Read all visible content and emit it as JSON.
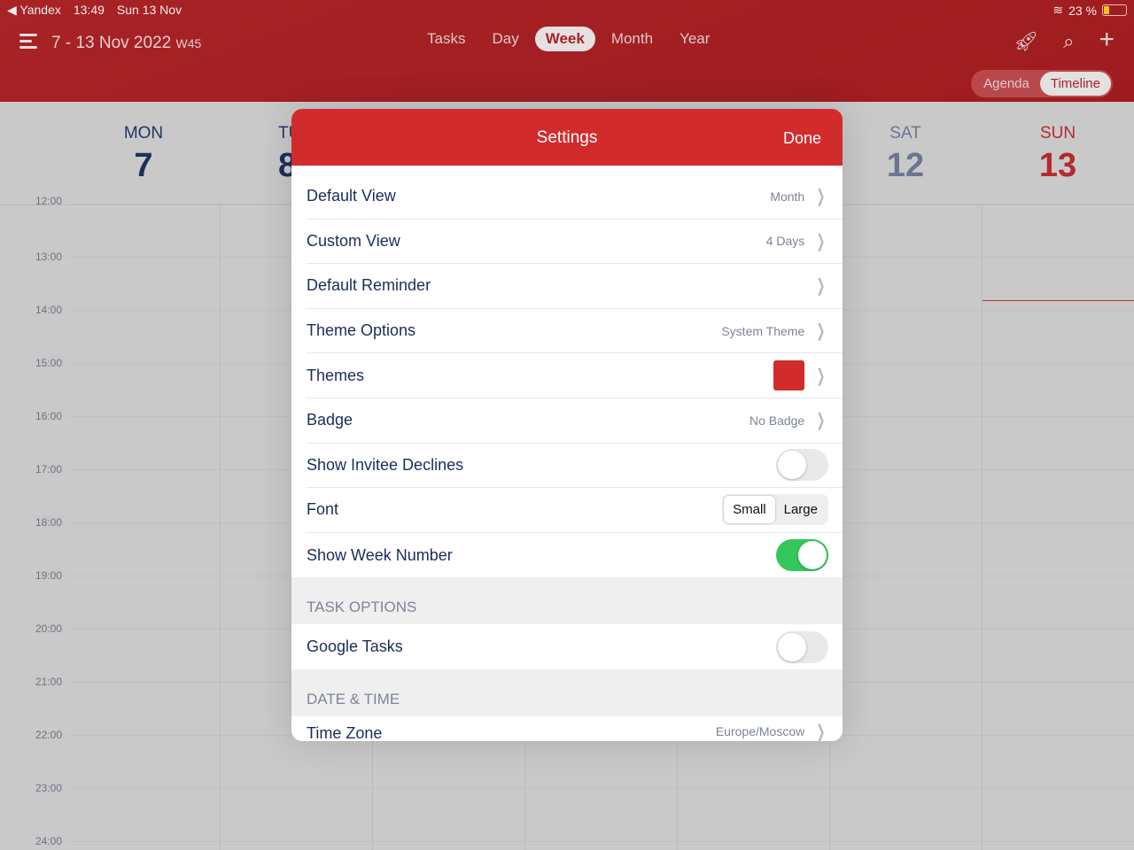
{
  "status": {
    "back_app": "Yandex",
    "time": "13:49",
    "date": "Sun 13 Nov",
    "battery": "23 %",
    "battery_level": 0.23
  },
  "header": {
    "range": "7 - 13 Nov 2022",
    "week": "W45",
    "tabs": [
      {
        "label": "Tasks"
      },
      {
        "label": "Day"
      },
      {
        "label": "Week",
        "active": true
      },
      {
        "label": "Month"
      },
      {
        "label": "Year"
      }
    ],
    "icons": [
      "rocket-icon",
      "search-icon",
      "plus-icon"
    ],
    "view_toggle": {
      "options": [
        "Agenda",
        "Timeline"
      ],
      "selected": "Timeline"
    }
  },
  "days": [
    {
      "name": "MON",
      "num": "7"
    },
    {
      "name": "TU",
      "num": "8"
    },
    {
      "name": "SAT",
      "num": "12"
    },
    {
      "name": "SUN",
      "num": "13",
      "today": true
    }
  ],
  "hours": [
    "12:00",
    "13:00",
    "14:00",
    "15:00",
    "16:00",
    "17:00",
    "18:00",
    "19:00",
    "20:00",
    "21:00",
    "22:00",
    "23:00",
    "24:00"
  ],
  "settings": {
    "title": "Settings",
    "done": "Done",
    "rows": [
      {
        "label": "Default View",
        "value": "Month"
      },
      {
        "label": "Custom View",
        "value": "4 Days"
      },
      {
        "label": "Default Reminder",
        "value": ""
      },
      {
        "label": "Theme Options",
        "value": "System Theme"
      },
      {
        "label": "Themes",
        "color": "#d22b2c"
      },
      {
        "label": "Badge",
        "value": "No Badge"
      },
      {
        "label": "Show Invitee Declines",
        "toggle": false
      },
      {
        "label": "Font",
        "options": [
          "Small",
          "Large"
        ],
        "selected": "Small"
      },
      {
        "label": "Show Week Number",
        "toggle": true
      }
    ],
    "task_section": "TASK OPTIONS",
    "google_tasks": {
      "label": "Google Tasks",
      "toggle": false
    },
    "date_section": "DATE & TIME",
    "time_zone": {
      "label": "Time Zone",
      "value": "Europe/Moscow"
    }
  },
  "colors": {
    "header": "#a82226",
    "accent": "#d22b2c",
    "toggle_on": "#34c759"
  }
}
